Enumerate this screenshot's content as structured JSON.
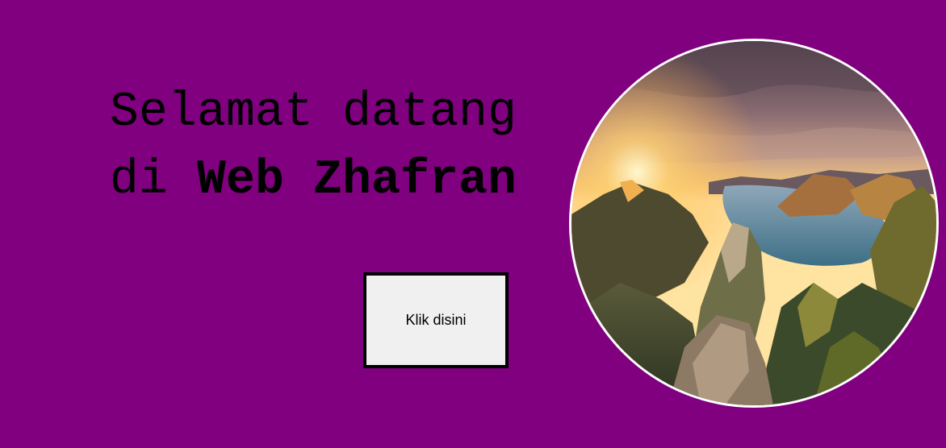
{
  "hero": {
    "line1": "Selamat datang",
    "line2_prefix": "di",
    "line2_bold": "Web Zhafran",
    "button_label": "Klik disini",
    "image_subject": "mountain-landscape-at-sunrise"
  },
  "colors": {
    "background": "#800080",
    "text": "#000000",
    "button_bg": "#f0f0f0",
    "button_border": "#000000",
    "image_border": "#ffffff"
  }
}
